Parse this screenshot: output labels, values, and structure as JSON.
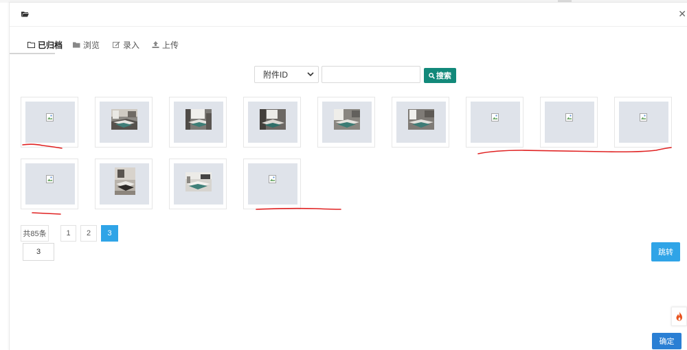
{
  "tabs": [
    {
      "label": "已归档",
      "icon": "folder-outline-icon",
      "active": true
    },
    {
      "label": "浏览",
      "icon": "folder-icon",
      "active": false
    },
    {
      "label": "录入",
      "icon": "edit-icon",
      "active": false
    },
    {
      "label": "上传",
      "icon": "upload-icon",
      "active": false
    }
  ],
  "search": {
    "select_value": "附件ID",
    "input_value": "",
    "button_label": "搜索"
  },
  "gallery": {
    "rows": [
      [
        "broken",
        "photo",
        "photo",
        "photo",
        "photo",
        "photo",
        "broken",
        "broken",
        "broken"
      ],
      [
        "broken",
        "photo",
        "photo",
        "broken"
      ]
    ]
  },
  "pagination": {
    "total_label": "共85条",
    "pages": [
      "1",
      "2",
      "3"
    ],
    "current": "3",
    "goto_value": "3",
    "goto_label": "跳转"
  },
  "footer": {
    "confirm_label": "确定"
  },
  "colors": {
    "search_button": "#12897a",
    "pagination_active": "#2fa4e7",
    "confirm_button": "#2a7fd4",
    "annotation": "#e02020"
  }
}
